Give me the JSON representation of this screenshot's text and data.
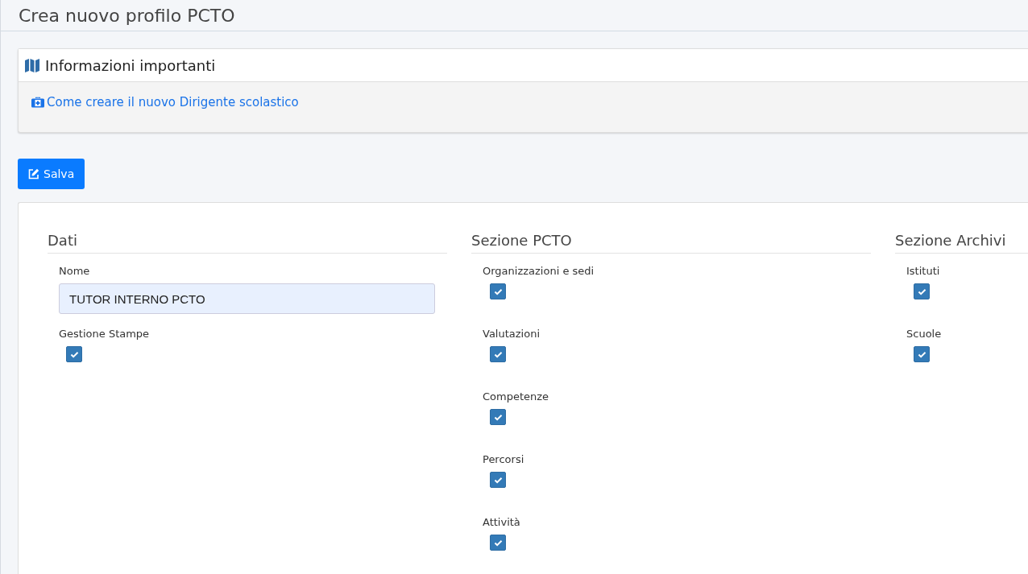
{
  "page_title": "Crea nuovo profilo PCTO",
  "info_panel": {
    "title": "Informazioni importanti",
    "link": "Come creare il nuovo Dirigente scolastico"
  },
  "save_button": "Salva",
  "sections": [
    {
      "title": "Dati",
      "fields": [
        {
          "kind": "text",
          "label": "Nome",
          "value": "TUTOR INTERNO PCTO"
        },
        {
          "kind": "checkbox",
          "label": "Gestione Stampe",
          "checked": true
        }
      ]
    },
    {
      "title": "Sezione PCTO",
      "fields": [
        {
          "kind": "checkbox",
          "label": "Organizzazioni e sedi",
          "checked": true
        },
        {
          "kind": "checkbox",
          "label": "Valutazioni",
          "checked": true
        },
        {
          "kind": "checkbox",
          "label": "Competenze",
          "checked": true
        },
        {
          "kind": "checkbox",
          "label": "Percorsi",
          "checked": true
        },
        {
          "kind": "checkbox",
          "label": "Attività",
          "checked": true
        }
      ]
    },
    {
      "title": "Sezione Archivi",
      "fields": [
        {
          "kind": "checkbox",
          "label": "Istituti",
          "checked": true
        },
        {
          "kind": "checkbox",
          "label": "Scuole",
          "checked": true
        }
      ]
    }
  ]
}
